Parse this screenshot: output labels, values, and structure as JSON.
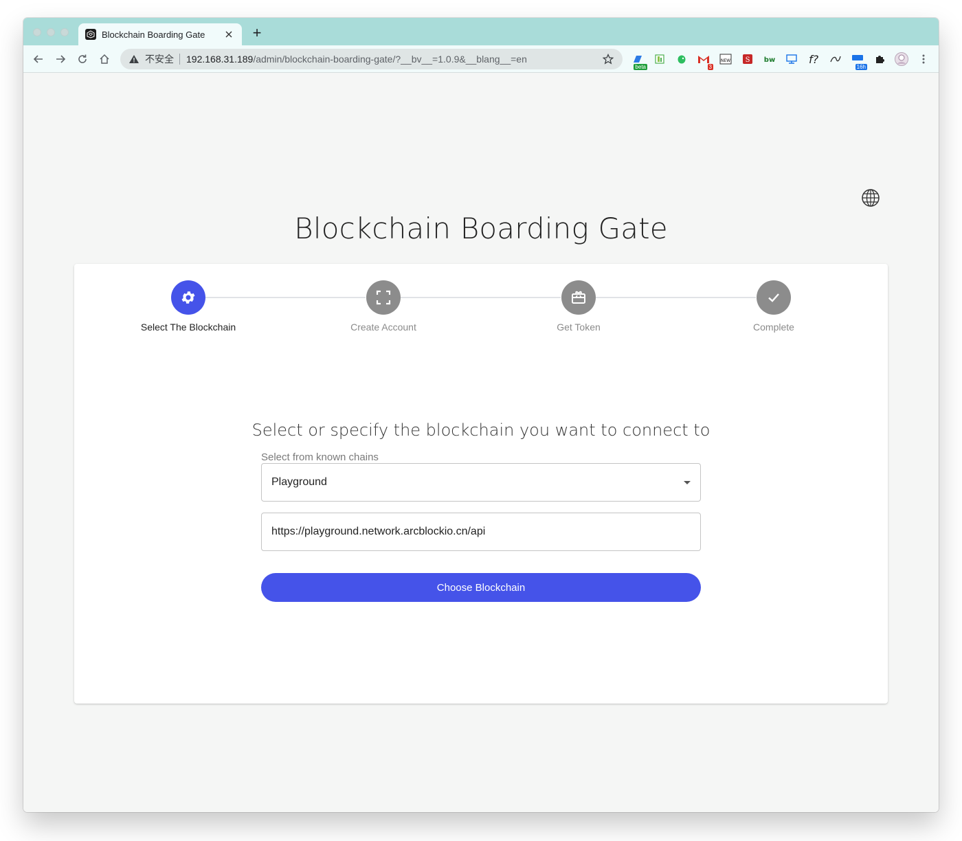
{
  "browser": {
    "tab": {
      "title": "Blockchain Boarding Gate",
      "close_icon": "close-icon",
      "favicon": "arcblock-logo"
    },
    "new_tab_label": "+",
    "omnibox": {
      "security_label": "不安全",
      "url_host": "192.168.31.189",
      "url_path": "/admin/blockchain-boarding-gate/?__bv__=1.0.9&__blang__=en"
    },
    "extensions": [
      {
        "name": "beta-extension",
        "badge": "beta",
        "badge_color": "#1e9e3a"
      },
      {
        "name": "book-extension",
        "badge": ""
      },
      {
        "name": "evernote-extension",
        "badge": ""
      },
      {
        "name": "gmail-extension",
        "badge": "3",
        "badge_color": "#d93025"
      },
      {
        "name": "news-extension",
        "badge": ""
      },
      {
        "name": "red-s-extension",
        "badge": ""
      },
      {
        "name": "bw-extension",
        "badge": ""
      },
      {
        "name": "screen-extension",
        "badge": ""
      },
      {
        "name": "formula-extension",
        "glyph": "f?",
        "badge": ""
      },
      {
        "name": "translate-extension",
        "badge": ""
      },
      {
        "name": "calendar-extension",
        "badge": "16h",
        "badge_color": "#1a73e8"
      },
      {
        "name": "puzzle-extension",
        "badge": ""
      },
      {
        "name": "profile-avatar",
        "badge": ""
      },
      {
        "name": "menu-extension",
        "badge": ""
      }
    ]
  },
  "page": {
    "title": "Blockchain Boarding Gate",
    "language_icon": "globe-icon",
    "steps": [
      {
        "label": "Select The Blockchain",
        "icon": "gear-icon",
        "active": true
      },
      {
        "label": "Create Account",
        "icon": "scan-icon",
        "active": false
      },
      {
        "label": "Get Token",
        "icon": "gift-card-icon",
        "active": false
      },
      {
        "label": "Complete",
        "icon": "check-icon",
        "active": false
      }
    ],
    "prompt": "Select or specify the blockchain you want to connect to",
    "select_label": "Select from known chains",
    "select_value": "Playground",
    "endpoint_value": "https://playground.network.arcblockio.cn/api",
    "submit_label": "Choose Blockchain",
    "colors": {
      "primary": "#4553e9",
      "inactive_step": "#8c8c8c"
    }
  }
}
